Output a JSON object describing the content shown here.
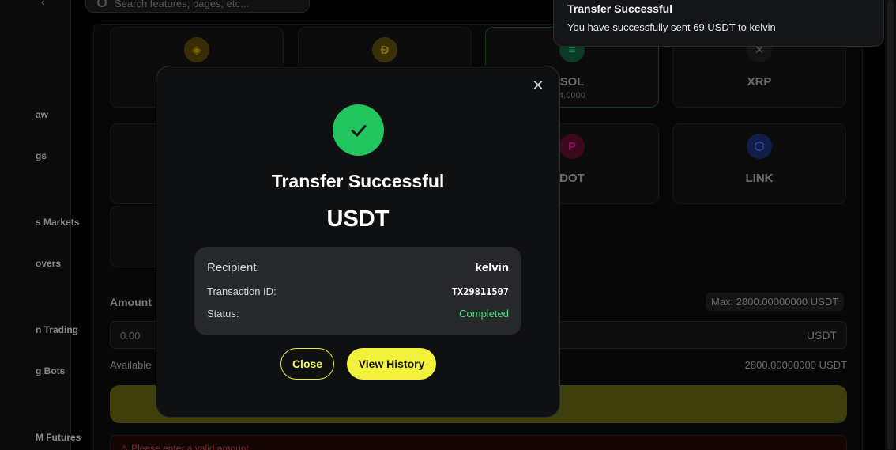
{
  "sidebar": {
    "items": [
      {
        "label": "aw"
      },
      {
        "label": "gs"
      },
      {
        "label": "s Markets"
      },
      {
        "label": "overs"
      },
      {
        "label": "n Trading"
      },
      {
        "label": "g Bots"
      },
      {
        "label": "M Futures"
      }
    ]
  },
  "search": {
    "placeholder": "Search features, pages, etc..."
  },
  "coins": [
    {
      "name": "",
      "sub": "",
      "icon": "bnb-icon",
      "color": "#f0b90b"
    },
    {
      "name": "",
      "sub": "",
      "icon": "doge-icon",
      "color": "#c2a633"
    },
    {
      "name": "SOL",
      "sub": "4.0000",
      "icon": "sol-icon",
      "color": "#14f195"
    },
    {
      "name": "XRP",
      "sub": "",
      "icon": "xrp-icon",
      "color": "#cccccc"
    },
    {
      "name": "DOT",
      "sub": "",
      "icon": "dot-icon",
      "color": "#e6007a"
    },
    {
      "name": "LINK",
      "sub": "",
      "icon": "link-icon",
      "color": "#2a5ada"
    }
  ],
  "form": {
    "amount_label": "Amount",
    "max_text": "Max: 2800.00000000 USDT",
    "amount_value": "0.00",
    "amount_unit": "USDT",
    "available_label": "Available",
    "available_value": "2800.00000000 USDT",
    "error_text": "Please enter a valid amount"
  },
  "toast": {
    "title": "Transfer Successful",
    "message": "You have successfully sent 69 USDT to kelvin"
  },
  "modal": {
    "title": "Transfer Successful",
    "coin": "USDT",
    "recipient_label": "Recipient:",
    "recipient_value": "kelvin",
    "txid_label": "Transaction ID:",
    "txid_value": "TX29811507",
    "status_label": "Status:",
    "status_value": "Completed",
    "close_label": "Close",
    "history_label": "View History"
  },
  "colors": {
    "accent_yellow": "#f2f23c",
    "success_green": "#22c55e",
    "status_green": "#4ade80"
  }
}
